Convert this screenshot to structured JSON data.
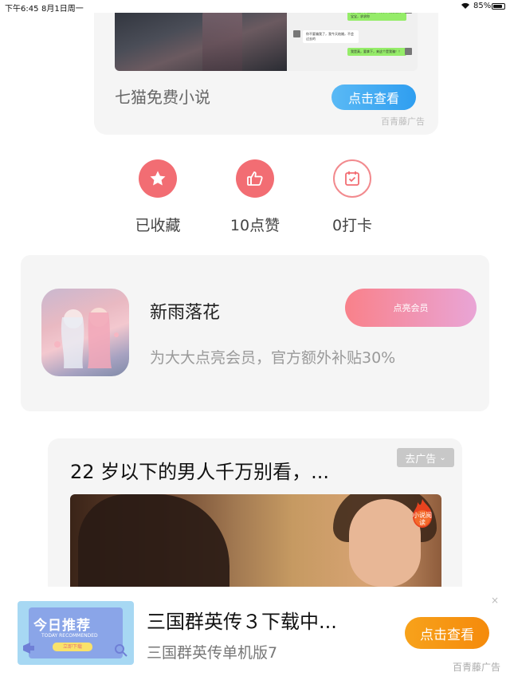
{
  "status_bar": {
    "time": "下午6:45",
    "date": "8月1日周一",
    "battery": "85%",
    "battery_level": 0.85
  },
  "top_ad": {
    "title": "七猫免费小说",
    "button": "点击查看",
    "source": "百青藤广告",
    "chat_lines": [
      "发，我怀孕已经三个月了，我想要嫁宝宝，求求你",
      "你不要骗我了，我今天结婚，不会过去的",
      "我是真，要拿下，来这个是我骗！！"
    ]
  },
  "actions": [
    {
      "label": "已收藏",
      "icon": "star-icon"
    },
    {
      "label": "10点赞",
      "icon": "thumbs-up-icon"
    },
    {
      "label": "0打卡",
      "icon": "calendar-check-icon"
    }
  ],
  "member": {
    "name": "新雨落花",
    "button": "点亮会员",
    "description": "为大大点亮会员，官方额外补贴30%"
  },
  "feed_ad": {
    "title": "22 岁以下的男人千万别看，...",
    "close_label": "去广告",
    "badge": "小说阅读"
  },
  "bottom_ad": {
    "title": "三国群英传３下载中...",
    "subtitle": "三国群英传单机版7",
    "button": "点击查看",
    "close": "×",
    "source": "百青藤广告",
    "image_title": "今日推荐",
    "image_sub": "TODAY RECOMMENDED",
    "image_pill": "立即下载"
  },
  "colors": {
    "accent_red": "#f26d73",
    "blue_button": "#2f9ef0",
    "orange_button": "#f58a0b"
  }
}
